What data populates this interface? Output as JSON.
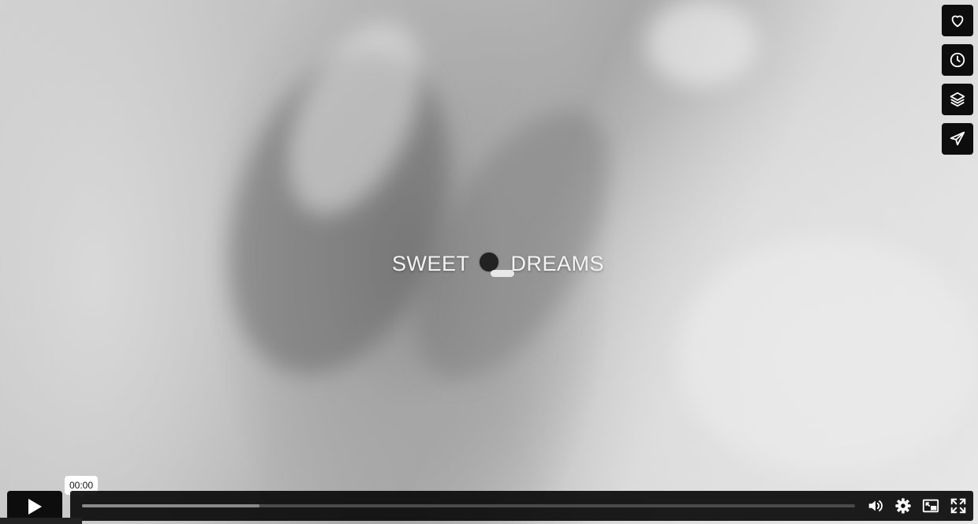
{
  "video": {
    "overlay_text_left": "SWEET",
    "overlay_text_right": "DREAMS",
    "overlay_icon": "moon-with-cloud-icon"
  },
  "side_buttons": [
    {
      "name": "like-button",
      "icon": "heart-icon"
    },
    {
      "name": "watch-later-button",
      "icon": "clock-icon"
    },
    {
      "name": "collections-button",
      "icon": "layers-icon"
    },
    {
      "name": "share-button",
      "icon": "paper-plane-icon"
    }
  ],
  "controls": {
    "current_time": "00:00",
    "buffered_fraction": 0.23,
    "play_icon": "play-icon",
    "icons": [
      "volume-icon",
      "settings-gear-icon",
      "picture-in-picture-icon",
      "fullscreen-icon"
    ]
  },
  "colors": {
    "control_bg": "#0d0d0d",
    "track": "#4a4a4a",
    "buffered": "#8a8a8a",
    "icon": "#ffffff"
  }
}
